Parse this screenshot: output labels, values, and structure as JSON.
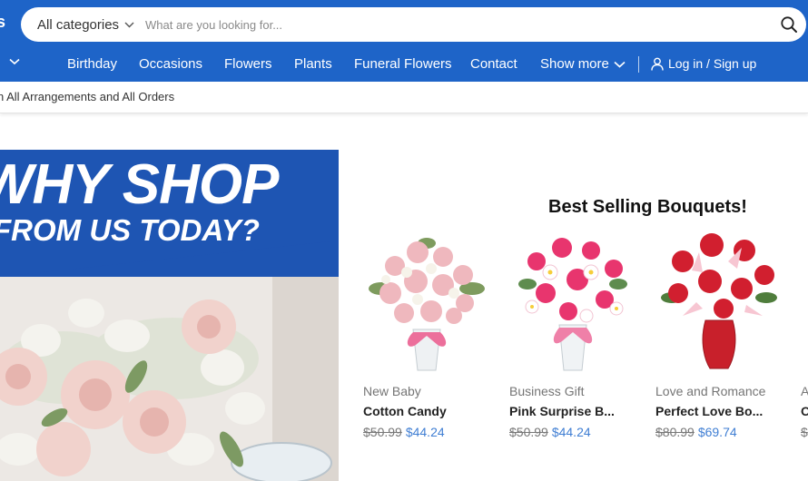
{
  "header": {
    "colors": {
      "brand": "#1e64c8",
      "hero_blue": "#1e55b3",
      "price_sale": "#3f7ed3"
    },
    "logo_fragment": "s",
    "search": {
      "category_label": "All categories",
      "placeholder": "What are you looking for...",
      "icons": {
        "dropdown": "chevron-down-icon",
        "search": "search-icon"
      }
    },
    "nav": {
      "items": [
        "Birthday",
        "Occasions",
        "Flowers",
        "Plants",
        "Funeral Flowers",
        "Contact"
      ],
      "show_more": "Show more",
      "login": "Log in / Sign up",
      "icons": {
        "menu": "chevron-down-icon",
        "login": "user-icon"
      }
    }
  },
  "subbar": {
    "text": "n All Arrangements and All Orders"
  },
  "hero": {
    "line1": "WHY SHOP",
    "line2": "FROM US TODAY?"
  },
  "best_sellers": {
    "title": "Best Selling Bouquets!",
    "products": [
      {
        "category": "New Baby",
        "name": "Cotton Candy",
        "old_price": "$50.99",
        "new_price": "$44.24"
      },
      {
        "category": "Business Gift",
        "name": "Pink Surprise B...",
        "old_price": "$50.99",
        "new_price": "$44.24"
      },
      {
        "category": "Love and Romance",
        "name": "Perfect Love Bo...",
        "old_price": "$80.99",
        "new_price": "$69.74"
      },
      {
        "category": "A",
        "name": "O",
        "old_price": "$",
        "new_price": ""
      }
    ]
  }
}
